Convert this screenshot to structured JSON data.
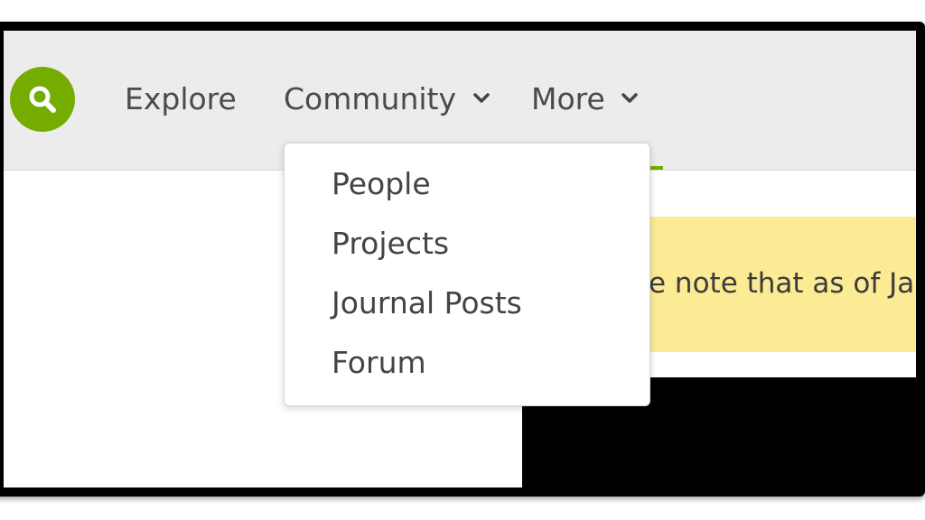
{
  "nav": {
    "search_icon": "search-icon",
    "items": [
      {
        "label": "Explore"
      },
      {
        "label": "Community",
        "icon": "chevron-down-icon"
      },
      {
        "label": "More",
        "icon": "chevron-down-icon"
      }
    ]
  },
  "dropdown": {
    "items": [
      {
        "label": "People"
      },
      {
        "label": "Projects"
      },
      {
        "label": "Journal Posts"
      },
      {
        "label": "Forum"
      }
    ]
  },
  "notice": {
    "text": "e note that as of Janu"
  },
  "colors": {
    "accent": "#74ac00",
    "navbar_bg": "#ececec",
    "notice_bg": "#fbeb94",
    "text": "#4a4a4a"
  }
}
